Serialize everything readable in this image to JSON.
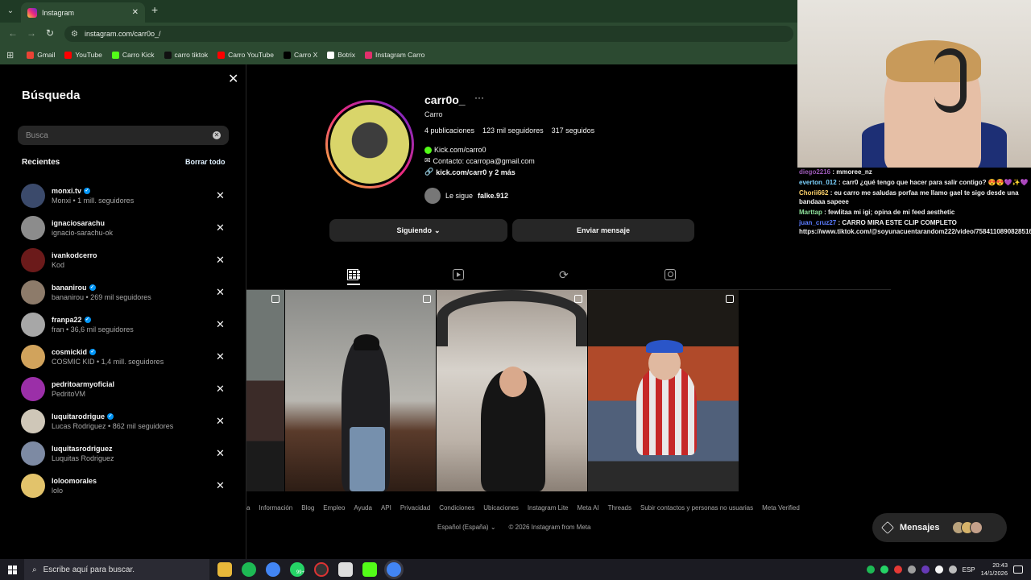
{
  "browser": {
    "tab_title": "Instagram",
    "url": "instagram.com/carr0o_/",
    "bookmarks": [
      {
        "label": "Gmail",
        "color": "#ea4335"
      },
      {
        "label": "YouTube",
        "color": "#ff0000"
      },
      {
        "label": "Carro Kick",
        "color": "#53fc18"
      },
      {
        "label": "carro tiktok",
        "color": "#111111"
      },
      {
        "label": "Carro YouTube",
        "color": "#ff0000"
      },
      {
        "label": "Carro X",
        "color": "#000000"
      },
      {
        "label": "Botrix",
        "color": "#ffffff"
      },
      {
        "label": "Instagram Carro",
        "color": "#e1306c"
      }
    ]
  },
  "search": {
    "title": "Búsqueda",
    "placeholder": "Busca",
    "recent_label": "Recientes",
    "clear_all": "Borrar todo",
    "items": [
      {
        "username": "monxi.tv",
        "verified": true,
        "sub": "Monxi • 1 mill. seguidores",
        "color": "#3b4a6b"
      },
      {
        "username": "ignaciosarachu",
        "verified": false,
        "sub": "ignacio-sarachu-ok",
        "color": "#8c8c8c"
      },
      {
        "username": "ivankodcerro",
        "verified": false,
        "sub": "Kod",
        "color": "#6b1a1a"
      },
      {
        "username": "bananirou",
        "verified": true,
        "sub": "bananirou • 269 mil seguidores",
        "color": "#8d7b6a"
      },
      {
        "username": "franpa22",
        "verified": true,
        "sub": "fran • 36,6 mil seguidores",
        "color": "#a7a7a7"
      },
      {
        "username": "cosmickid",
        "verified": true,
        "sub": "COSMIC KID • 1,4 mill. seguidores",
        "color": "#d1a35c"
      },
      {
        "username": "pedritoarmyoficial",
        "verified": false,
        "sub": "PedritoVM",
        "color": "#9b2fa8"
      },
      {
        "username": "luquitarodrigue",
        "verified": true,
        "sub": "Lucas Rodriguez • 862 mil seguidores",
        "color": "#cfc7b8"
      },
      {
        "username": "luquitasrodriguez",
        "verified": false,
        "sub": "Luquitas Rodriguez",
        "color": "#7d8aa3"
      },
      {
        "username": "loloomorales",
        "verified": false,
        "sub": "lolo",
        "color": "#e2c36b"
      }
    ]
  },
  "profile": {
    "username": "carr0o_",
    "more": "···",
    "full_name": "Carro",
    "posts": "4 publicaciones",
    "followers": "123 mil seguidores",
    "following": "317 seguidos",
    "bio_kick": "Kick.com/carro0",
    "bio_contact": "Contacto: ccarropa@gmail.com",
    "bio_link": "kick.com/carr0 y 2 más",
    "followed_by_prefix": "Le sigue",
    "followed_by_user": "falke.912",
    "following_btn": "Siguiendo",
    "message_btn": "Enviar mensaje"
  },
  "footer": {
    "links": [
      "a",
      "Información",
      "Blog",
      "Empleo",
      "Ayuda",
      "API",
      "Privacidad",
      "Condiciones",
      "Ubicaciones",
      "Instagram Lite",
      "Meta AI",
      "Threads",
      "Subir contactos y personas no usuarias",
      "Meta Verified"
    ],
    "language": "Español (España)",
    "copyright": "© 2026 Instagram from Meta"
  },
  "messages": {
    "label": "Mensajes"
  },
  "chat": [
    {
      "user": "diego2216",
      "text": ": mmoree_nz",
      "color": "#9b59b6"
    },
    {
      "user": "everton_012",
      "text": ": carr0 ¿qué tengo que hacer para salir contigo? 😍😍💜✨💜",
      "color": "#7cd3ff"
    },
    {
      "user": "Chorii662",
      "text": ": eu carro me saludas porfaa me llamo gael te sigo desde una bandaaa sapeee",
      "color": "#ffd36b"
    },
    {
      "user": "Marttap",
      "text": ": fewlitaa mi igi; opina de mi feed aesthetic",
      "color": "#8fe39c"
    },
    {
      "user": "juan_cruz27",
      "text": ": CARRO MIRA ESTE CLIP COMPLETO https://www.tiktok.com/@soyunacuentarandom222/video/7584110890828516630?",
      "color": "#5b7cff"
    }
  ],
  "taskbar": {
    "search_placeholder": "Escribe aquí para buscar.",
    "lang": "ESP",
    "time": "20:43",
    "date": "14/1/2026",
    "badge": "99+"
  }
}
